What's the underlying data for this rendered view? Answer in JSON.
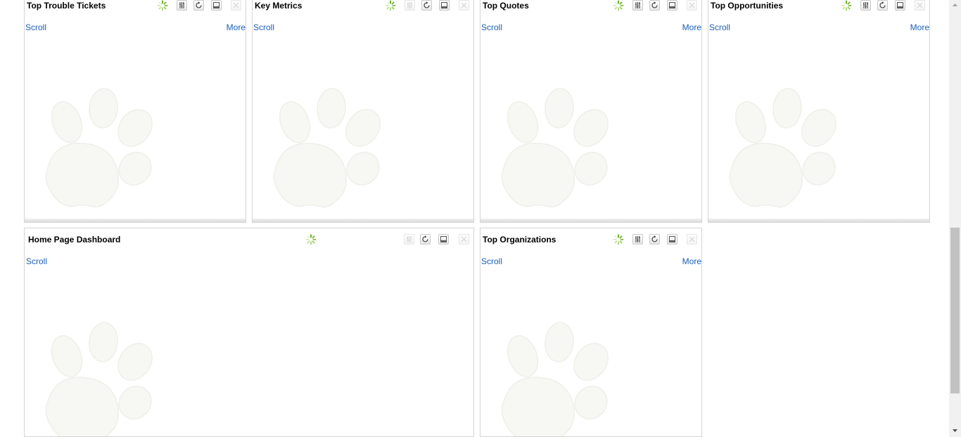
{
  "widgets": {
    "trouble_tickets": {
      "title": "Top Trouble Tickets",
      "scroll": "Scroll",
      "more": "More"
    },
    "key_metrics": {
      "title": "Key Metrics",
      "scroll": "Scroll"
    },
    "top_quotes": {
      "title": "Top Quotes",
      "scroll": "Scroll",
      "more": "More"
    },
    "top_opportunities": {
      "title": "Top Opportunities",
      "scroll": "Scroll",
      "more": "More"
    },
    "home_dashboard": {
      "title": "Home Page Dashboard",
      "scroll": "Scroll"
    },
    "top_organizations": {
      "title": "Top Organizations",
      "scroll": "Scroll",
      "more": "More"
    }
  },
  "icons": {
    "spinner": "loading-spinner-icon",
    "settings": "settings-sliders-icon",
    "refresh": "refresh-icon",
    "minimize": "minimize-icon",
    "close": "close-icon",
    "watermark": "paw-print-icon"
  },
  "colors": {
    "link": "#1a5fb4",
    "border": "#d4d4d4",
    "spinner": "#6cae2b"
  }
}
